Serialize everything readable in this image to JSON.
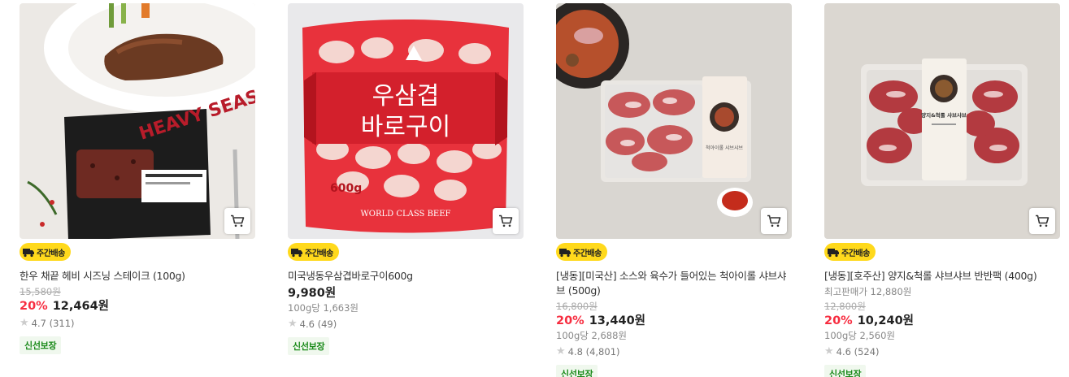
{
  "badge_label": "주간배송",
  "fresh_label": "신선보장",
  "products": [
    {
      "name": "한우 채끝 헤비 시즈닝 스테이크 (100g)",
      "original_price": "15,580원",
      "discount": "20%",
      "price": "12,464원",
      "rating": "4.7 (311)",
      "image_text": "HEAVY SEASONING STEAK"
    },
    {
      "name": "미국냉동우삼겹바로구이600g",
      "price": "9,980원",
      "unit_price": "100g당 1,663원",
      "rating": "4.6 (49)",
      "image_text_1": "우삼겹",
      "image_text_2": "바로구이",
      "image_weight": "600g",
      "image_brand": "WORLD CLASS BEEF"
    },
    {
      "name": "[냉동][미국산] 소스와 육수가 들어있는 척아이롤 샤브샤브 (500g)",
      "original_price": "16,800원",
      "discount": "20%",
      "price": "13,440원",
      "unit_price": "100g당 2,688원",
      "rating": "4.8 (4,801)",
      "image_label": "척아이롤 샤브샤브"
    },
    {
      "name": "[냉동][호주산] 양지&척롤 샤브샤브 반반팩 (400g)",
      "best_price": "최고판매가 12,880원",
      "original_price": "12,800원",
      "discount": "20%",
      "price": "10,240원",
      "unit_price": "100g당 2,560원",
      "rating": "4.6 (524)",
      "image_label": "양지&척롤 샤브샤브"
    }
  ],
  "icons": {
    "cart": "cart-icon",
    "truck": "truck-icon",
    "star": "star-icon"
  },
  "colors": {
    "discount": "#f72d40",
    "badge": "#ffd91c",
    "fresh": "#1a8a1a"
  }
}
